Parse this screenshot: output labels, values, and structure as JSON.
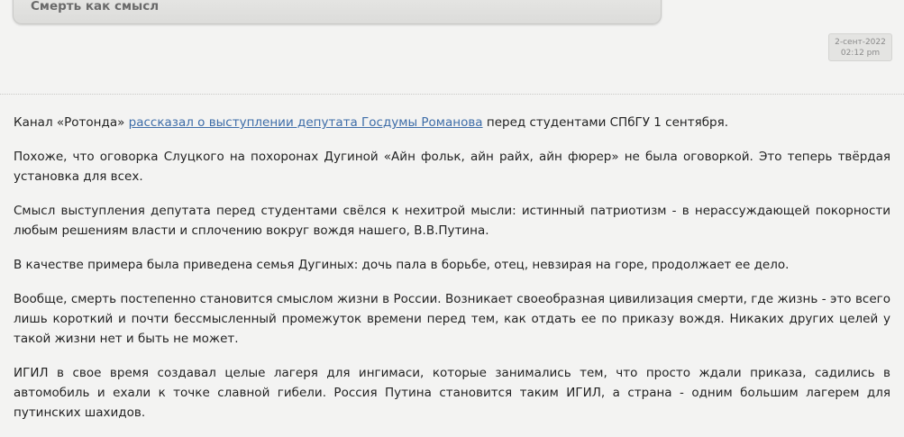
{
  "post": {
    "title": "Смерть как смысл",
    "date_line1": "2-сент-2022",
    "date_line2": "02:12 pm"
  },
  "content": {
    "p1_before": "Канал «Ротонда» ",
    "p1_link": "рассказал о выступлении депутата Госдумы Романова",
    "p1_after": " перед студентами СПбГУ 1 сентября.",
    "p2": "Похоже, что оговорка Слуцкого на похоронах Дугиной «Айн фольк, айн райх, айн фюрер» не была оговоркой. Это теперь твёрдая установка для всех.",
    "p3": "Смысл выступления депутата перед студентами свёлся к нехитрой мысли: истинный патриотизм - в нерассуждающей покорности любым решениям власти и сплочению вокруг вождя нашего, В.В.Путина.",
    "p4": "В качестве примера была приведена семья Дугиных: дочь пала в борьбе, отец, невзирая на горе, продолжает ее дело.",
    "p5": "Вообще, смерть постепенно становится смыслом жизни в России. Возникает своеобразная цивилизация смерти, где жизнь - это всего лишь короткий и почти бессмысленный промежуток времени перед тем, как отдать ее по приказу вождя. Никаких других целей у такой жизни нет и быть не может.",
    "p6": "ИГИЛ в свое время создавал целые лагеря для ингимаси, которые занимались тем, что просто ждали приказа, садились в автомобиль и ехали к точке славной гибели. Россия Путина становится таким ИГИЛ, а страна - одним большим лагерем для путинских шахидов."
  }
}
